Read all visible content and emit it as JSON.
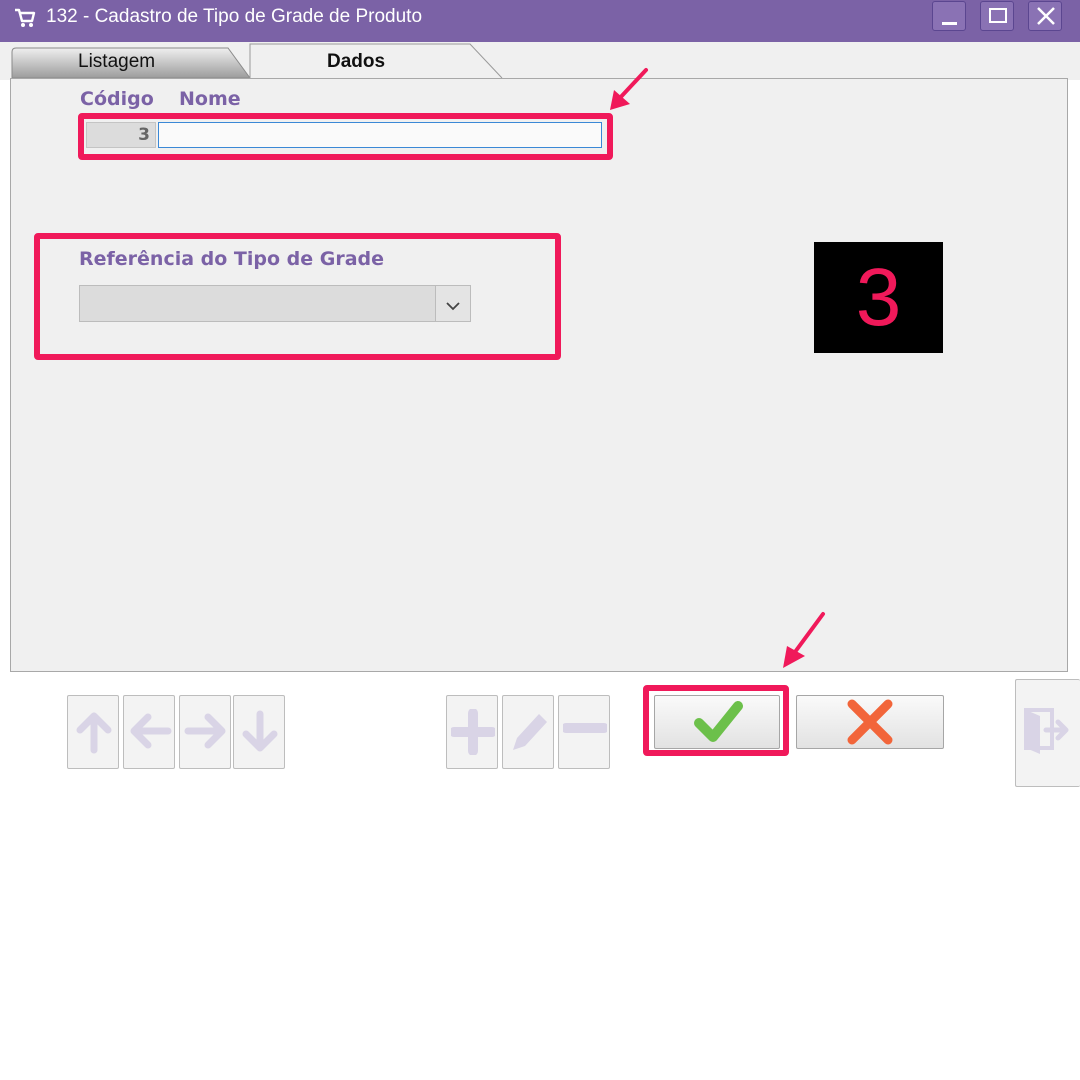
{
  "window": {
    "title": "132 - Cadastro de Tipo de Grade de Produto",
    "icon": "cart-icon",
    "controls": [
      "minimize-icon",
      "maximize-icon",
      "close-icon"
    ]
  },
  "tabs": [
    {
      "label": "Listagem",
      "active": false
    },
    {
      "label": "Dados",
      "active": true
    }
  ],
  "form": {
    "codigo_label": "Código",
    "nome_label": "Nome",
    "codigo_value": "3",
    "nome_value": "",
    "referencia_label": "Referência do Tipo de Grade",
    "referencia_value": ""
  },
  "annotation": {
    "step_number": "3",
    "highlight_color": "#f0195a"
  },
  "toolbar": {
    "nav_icons": [
      "arrow-up-icon",
      "arrow-left-icon",
      "arrow-right-icon",
      "arrow-down-icon"
    ],
    "edit_icons": [
      "plus-icon",
      "pencil-icon",
      "minus-icon"
    ],
    "confirm_icon": "checkmark-icon",
    "cancel_icon": "x-icon",
    "exit_icon": "exit-door-icon"
  },
  "colors": {
    "accent": "#7b62a6",
    "confirm": "#6cc04a",
    "cancel": "#f2653a",
    "disabled_icon": "#d9d4e6"
  }
}
